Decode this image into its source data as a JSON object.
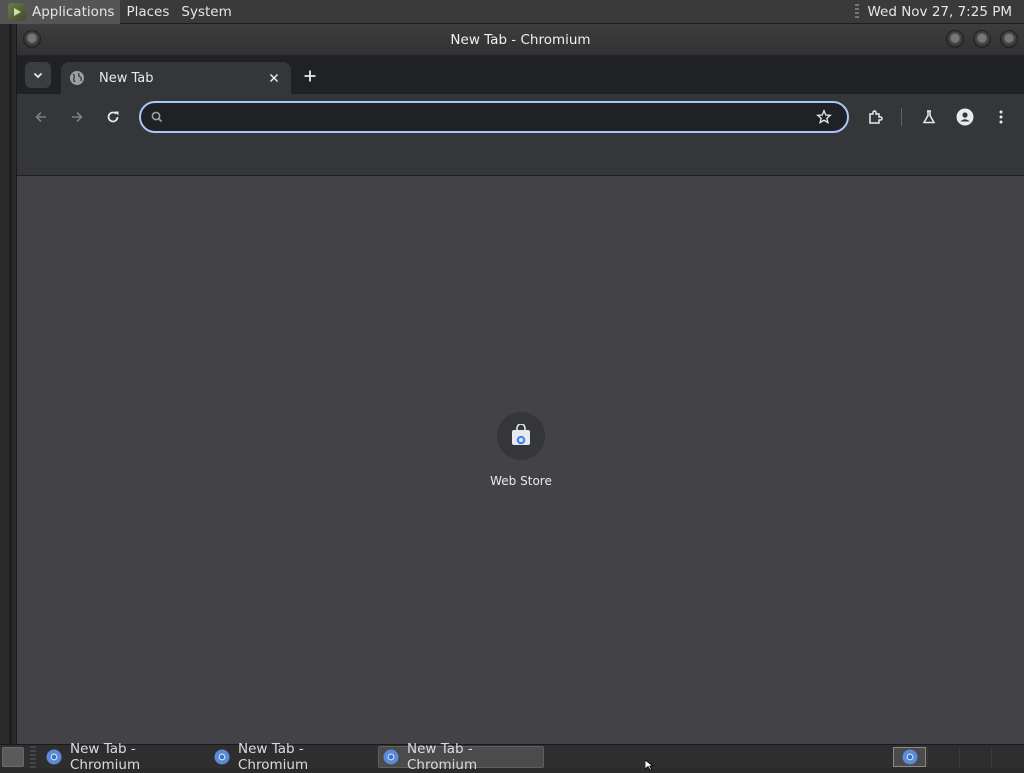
{
  "top_panel": {
    "menus": [
      "Applications",
      "Places",
      "System"
    ],
    "clock": "Wed Nov 27,  7:25 PM"
  },
  "window": {
    "title": "New Tab - Chromium"
  },
  "browser": {
    "tabs": [
      {
        "title": "New Tab",
        "icon": "globe-icon",
        "active": true
      }
    ],
    "omnibox": {
      "value": "",
      "placeholder": ""
    },
    "toolbar_icons": [
      "back-icon",
      "forward-icon",
      "reload-icon",
      "bookmark-star-icon",
      "extensions-icon",
      "labs-flask-icon",
      "profile-icon",
      "menu-kebab-icon"
    ]
  },
  "new_tab_page": {
    "shortcuts": [
      {
        "label": "Web Store",
        "icon": "web-store-icon"
      }
    ]
  },
  "taskbar": {
    "items": [
      {
        "label": "New Tab - Chromium",
        "active": false
      },
      {
        "label": "New Tab - Chromium",
        "active": false
      },
      {
        "label": "New Tab - Chromium",
        "active": true
      }
    ]
  },
  "colors": {
    "omnibox_focus_ring": "#a8c7fa",
    "content_background": "#434247",
    "toolbar_background": "#35363a",
    "tabstrip_background": "#202124"
  }
}
